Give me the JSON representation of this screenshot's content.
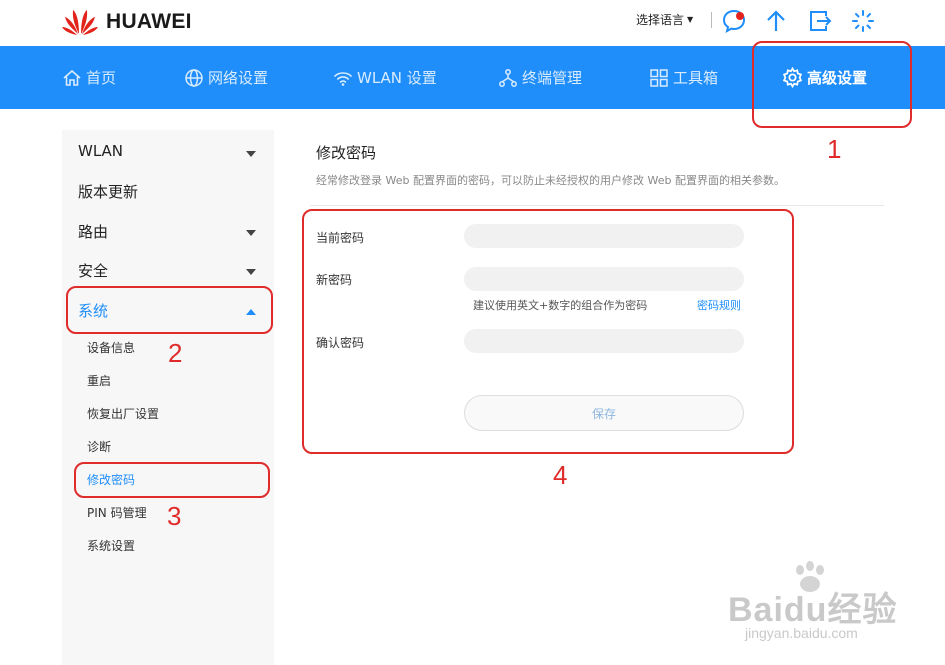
{
  "header": {
    "brand": "HUAWEI",
    "language_label": "选择语言",
    "icons": [
      "message-icon",
      "update-icon",
      "logout-icon",
      "loading-icon"
    ]
  },
  "nav": {
    "items": [
      {
        "label": "首页",
        "icon": "home-icon"
      },
      {
        "label": "网络设置",
        "icon": "globe-icon"
      },
      {
        "label": "WLAN 设置",
        "icon": "wifi-icon"
      },
      {
        "label": "终端管理",
        "icon": "network-icon"
      },
      {
        "label": "工具箱",
        "icon": "toolbox-icon"
      },
      {
        "label": "高级设置",
        "icon": "gear-icon",
        "active": true
      }
    ]
  },
  "sidebar": {
    "menus": [
      {
        "label": "WLAN",
        "expanded": false
      },
      {
        "label": "版本更新"
      },
      {
        "label": "路由",
        "expanded": false
      },
      {
        "label": "安全",
        "expanded": false
      },
      {
        "label": "系统",
        "expanded": true,
        "active": true
      }
    ],
    "submenu": [
      {
        "label": "设备信息"
      },
      {
        "label": "重启"
      },
      {
        "label": "恢复出厂设置"
      },
      {
        "label": "诊断"
      },
      {
        "label": "修改密码",
        "active": true
      },
      {
        "label": "PIN 码管理"
      },
      {
        "label": "系统设置"
      }
    ]
  },
  "main": {
    "title": "修改密码",
    "description": "经常修改登录 Web 配置界面的密码，可以防止未经授权的用户修改 Web 配置界面的相关参数。",
    "fields": [
      {
        "label": "当前密码",
        "value": ""
      },
      {
        "label": "新密码",
        "value": ""
      },
      {
        "label": "确认密码",
        "value": ""
      }
    ],
    "hint": "建议使用英文+数字的组合作为密码",
    "rules_link": "密码规则",
    "save_label": "保存"
  },
  "annotations": [
    "1",
    "2",
    "3",
    "4"
  ],
  "watermark": {
    "text": "Baidu经验",
    "url": "jingyan.baidu.com"
  },
  "colors": {
    "primary": "#1f8efa",
    "annotation": "#e02b2b"
  }
}
